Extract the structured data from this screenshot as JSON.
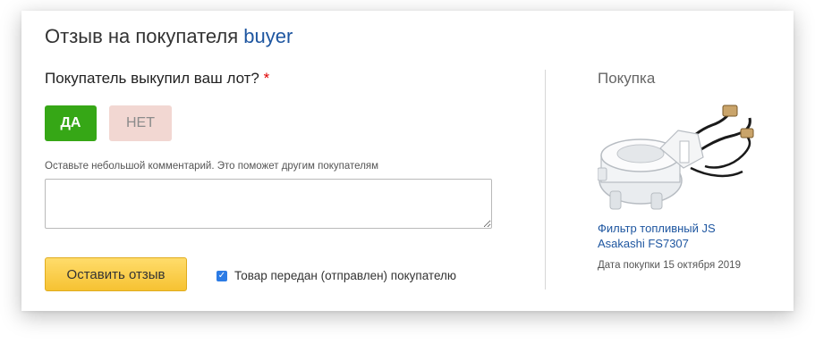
{
  "form": {
    "title_prefix": "Отзыв на покупателя",
    "username": "buyer",
    "question": "Покупатель выкупил ваш лот?",
    "required_mark": "*",
    "yes_label": "ДА",
    "no_label": "НЕТ",
    "comment_hint": "Оставьте небольшой комментарий. Это поможет другим покупателям",
    "comment_value": "",
    "submit_label": "Оставить отзыв",
    "shipped_checkbox": {
      "checked": true,
      "label": "Товар передан (отправлен) покупателю",
      "mark": "✓"
    }
  },
  "purchase": {
    "section_title": "Покупка",
    "product_image_icon": "fuel-filter-image",
    "product_name": "Фильтр топливный JS Asakashi FS7307",
    "purchase_date": "Дата покупки 15 октября 2019"
  },
  "colors": {
    "link": "#1e56a0",
    "yes_button": "#36a716",
    "no_button": "#f2d7d2",
    "submit_button": "#f6c232",
    "required": "#e00000"
  }
}
